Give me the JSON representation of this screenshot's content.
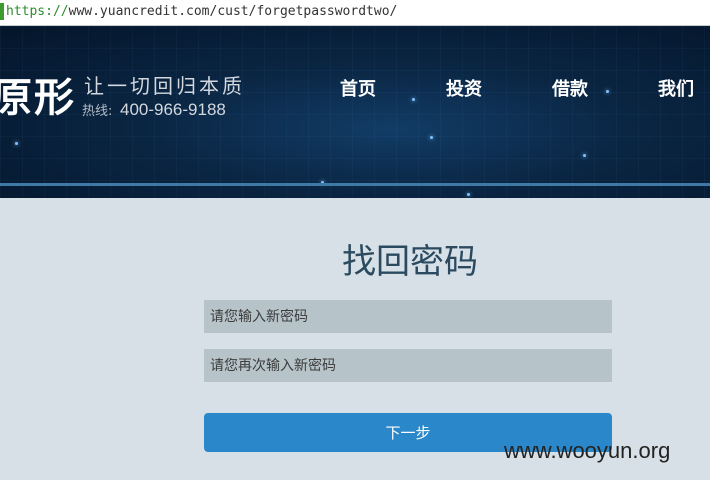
{
  "browser": {
    "url_scheme": "https://",
    "url_rest": "www.yuancredit.com/cust/forgetpasswordtwo/"
  },
  "header": {
    "logo_text": "原形",
    "slogan": "让一切回归本质",
    "hotline_label": "热线:",
    "hotline_number": "400-966-9188",
    "nav": [
      {
        "label": "首页"
      },
      {
        "label": "投资"
      },
      {
        "label": "借款"
      },
      {
        "label": "我们"
      }
    ]
  },
  "form": {
    "title": "找回密码",
    "new_password_placeholder": "请您输入新密码",
    "confirm_password_placeholder": "请您再次输入新密码",
    "next_button": "下一步"
  },
  "watermark": "www.wooyun.org",
  "colors": {
    "banner_dark": "#04152a",
    "page_bg": "#d6e0e6",
    "input_bg": "#b6c3c9",
    "button_bg": "#2a87c9",
    "title_color": "#2b4a60"
  }
}
